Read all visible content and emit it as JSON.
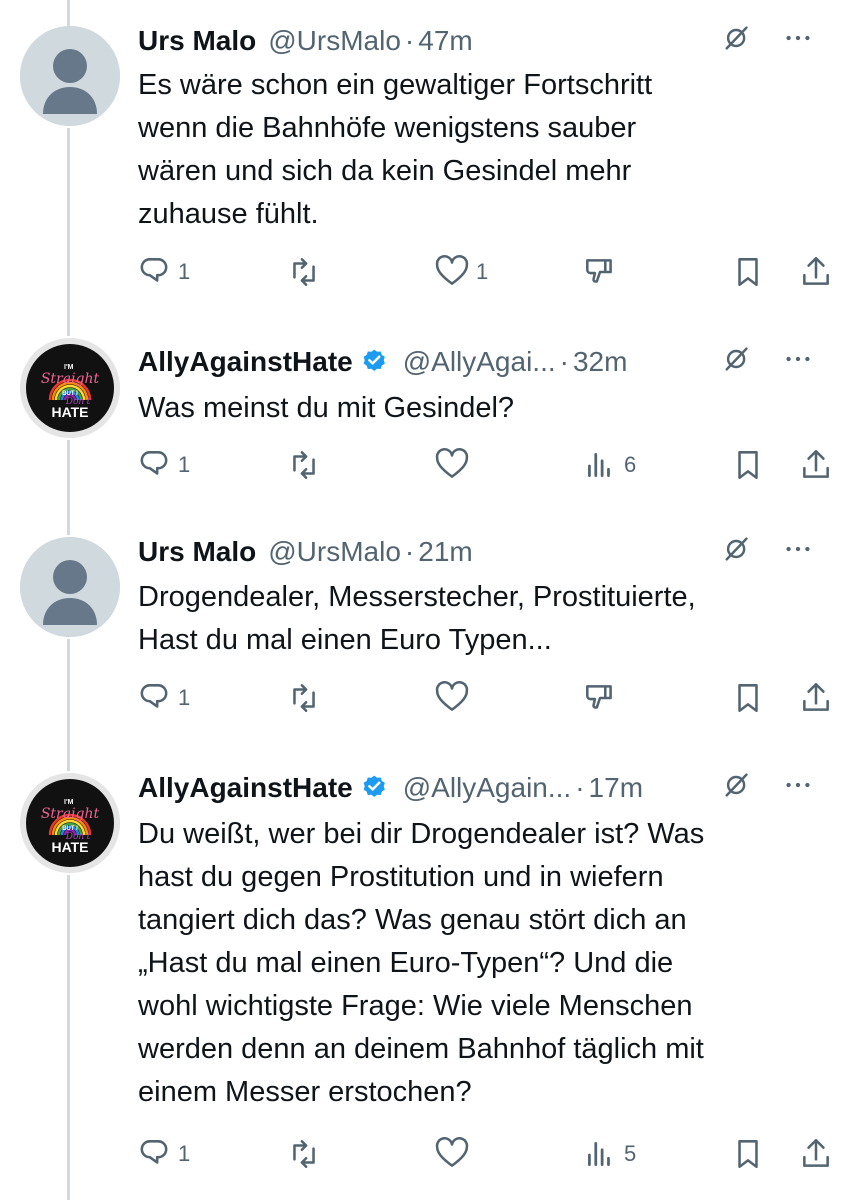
{
  "tweets": [
    {
      "name": "Urs Malo",
      "handle": "@UrsMalo",
      "time": "47m",
      "verified": false,
      "avatar": "default-avatar",
      "text": [
        "Es wäre schon ein gewaltiger Fortschritt",
        "wenn die Bahnhöfe wenigstens sauber",
        "wären und sich da kein Gesindel mehr",
        "zuhause fühlt."
      ],
      "replies": "1",
      "retweets": "",
      "likes": "1",
      "fourth_action": "downvote",
      "fourth_count": ""
    },
    {
      "name": "AllyAgainstHate",
      "handle": "@AllyAgai...",
      "time": "32m",
      "verified": true,
      "avatar": "ally-avatar",
      "text": [
        "Was meinst du mit Gesindel?"
      ],
      "replies": "1",
      "retweets": "",
      "likes": "",
      "fourth_action": "views",
      "fourth_count": "6"
    },
    {
      "name": "Urs Malo",
      "handle": "@UrsMalo",
      "time": "21m",
      "verified": false,
      "avatar": "default-avatar",
      "text": [
        "Drogendealer, Messerstecher, Prostituierte,",
        "Hast du mal einen Euro Typen..."
      ],
      "replies": "1",
      "retweets": "",
      "likes": "",
      "fourth_action": "downvote",
      "fourth_count": ""
    },
    {
      "name": "AllyAgainstHate",
      "handle": "@AllyAgain...",
      "time": "17m",
      "verified": true,
      "avatar": "ally-avatar",
      "text": [
        "Du weißt, wer bei dir Drogendealer ist? Was",
        "hast du gegen Prostitution und in wiefern",
        "tangiert dich das? Was genau stört dich an",
        "„Hast du mal einen Euro-Typen“? Und die",
        "wohl wichtigste Frage: Wie viele Menschen",
        "werden denn an deinem Bahnhof täglich mit",
        "einem Messer erstochen?"
      ],
      "replies": "1",
      "retweets": "",
      "likes": "",
      "fourth_action": "views",
      "fourth_count": "5"
    }
  ],
  "ally_badge": {
    "line1": "I'M",
    "line2": "Straight",
    "line3": "BUT I",
    "line4": "Don't",
    "line5": "HATE"
  },
  "colors": {
    "text": "#0f1419",
    "muted": "#536471",
    "verified": "#1d9bf0",
    "thread": "#cfd9de"
  }
}
